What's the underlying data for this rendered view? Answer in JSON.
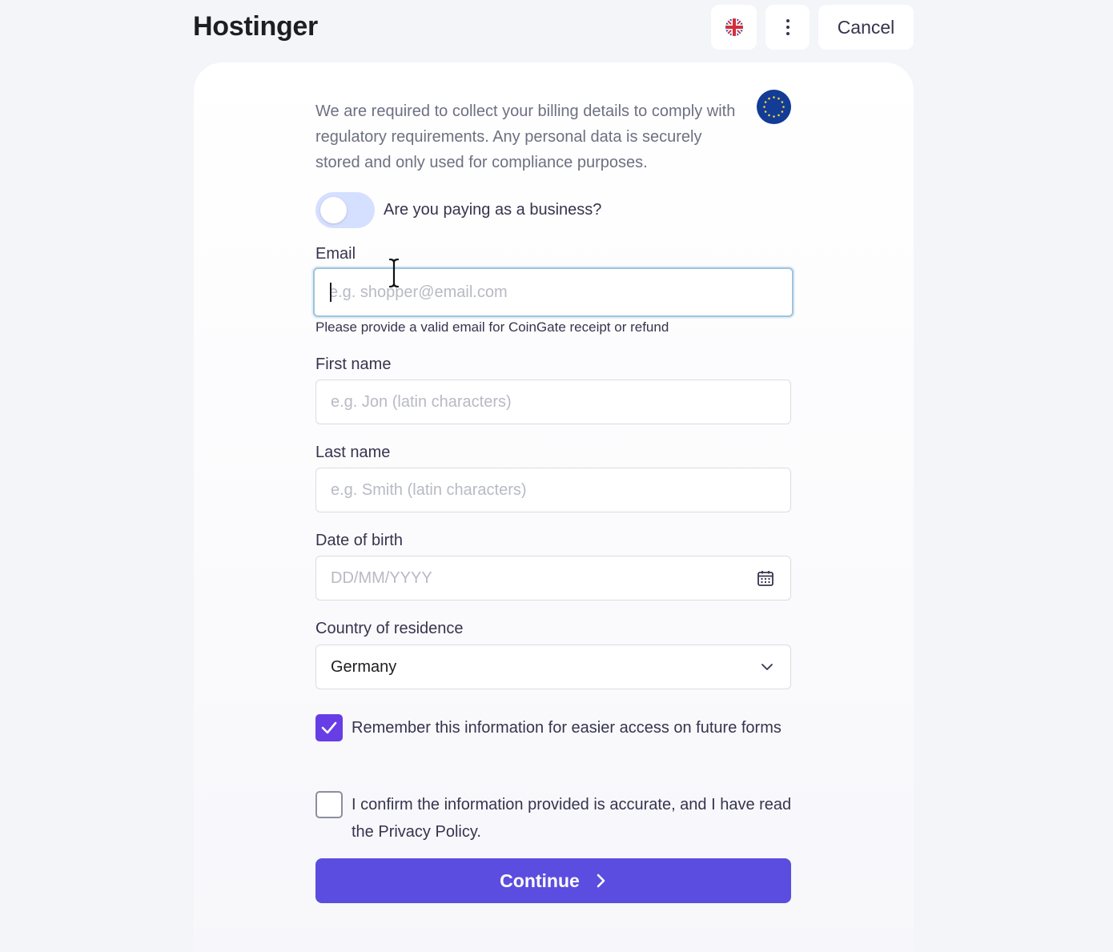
{
  "header": {
    "brand": "Hostinger",
    "language_icon": "uk-flag-icon",
    "more_icon": "vertical-dots-icon",
    "cancel_label": "Cancel"
  },
  "form": {
    "region_badge_icon": "eu-flag-icon",
    "intro_text": "We are required to collect your billing details to comply with regulatory requirements. Any personal data is securely stored and only used for compliance purposes.",
    "business_toggle": {
      "label": "Are you paying as a business?",
      "on": false
    },
    "email": {
      "label": "Email",
      "placeholder": "e.g. shopper@email.com",
      "value": "",
      "hint": "Please provide a valid email for CoinGate receipt or refund"
    },
    "first_name": {
      "label": "First name",
      "placeholder": "e.g. Jon (latin characters)",
      "value": ""
    },
    "last_name": {
      "label": "Last name",
      "placeholder": "e.g. Smith (latin characters)",
      "value": ""
    },
    "date_of_birth": {
      "label": "Date of birth",
      "placeholder": "DD/MM/YYYY",
      "value": "",
      "icon": "calendar-icon"
    },
    "country": {
      "label": "Country of residence",
      "selected": "Germany",
      "icon": "chevron-down-icon"
    },
    "remember": {
      "label": "Remember this information for easier access on future forms",
      "checked": true
    },
    "confirm": {
      "label": "I confirm the information provided is accurate, and I have read the Privacy Policy.",
      "checked": false
    },
    "continue_label": "Continue"
  },
  "colors": {
    "primary": "#5b4ddf",
    "checkbox_checked": "#673de6",
    "background": "#f4f5f9",
    "toggle_off": "#d5dfff",
    "focus_border": "#9fc3dc"
  }
}
